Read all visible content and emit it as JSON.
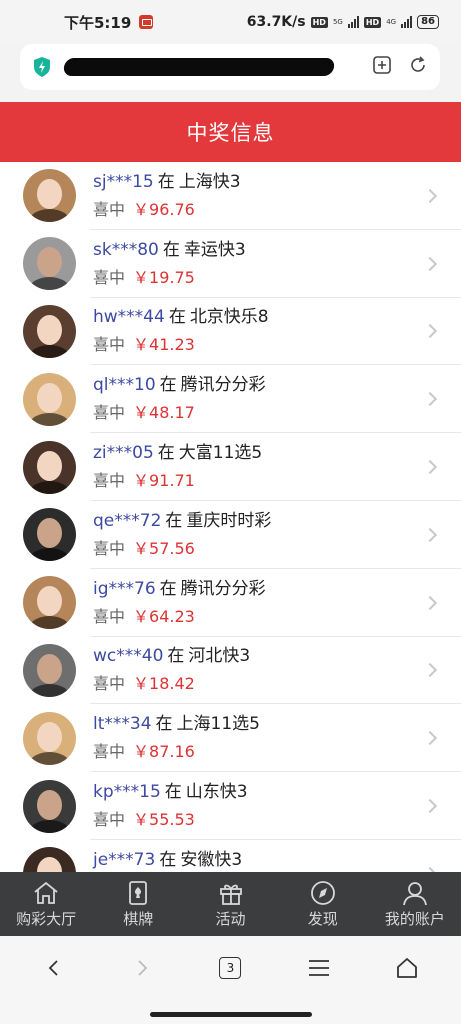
{
  "status": {
    "time": "下午5:19",
    "speed": "63.7K/s",
    "hd1": "HD",
    "net1": "5G",
    "hd2": "HD",
    "net2": "4G",
    "battery": "86"
  },
  "header": {
    "title": "中奖信息"
  },
  "list": {
    "items": [
      {
        "user": "sj***15",
        "zai": "在",
        "game": "上海快3",
        "label": "喜中",
        "amount": "￥96.76"
      },
      {
        "user": "sk***80",
        "zai": "在",
        "game": "幸运快3",
        "label": "喜中",
        "amount": "￥19.75"
      },
      {
        "user": "hw***44",
        "zai": "在",
        "game": "北京快乐8",
        "label": "喜中",
        "amount": "￥41.23"
      },
      {
        "user": "ql***10",
        "zai": "在",
        "game": "腾讯分分彩",
        "label": "喜中",
        "amount": "￥48.17"
      },
      {
        "user": "zi***05",
        "zai": "在",
        "game": "大富11选5",
        "label": "喜中",
        "amount": "￥91.71"
      },
      {
        "user": "qe***72",
        "zai": "在",
        "game": "重庆时时彩",
        "label": "喜中",
        "amount": "￥57.56"
      },
      {
        "user": "ig***76",
        "zai": "在",
        "game": "腾讯分分彩",
        "label": "喜中",
        "amount": "￥64.23"
      },
      {
        "user": "wc***40",
        "zai": "在",
        "game": "河北快3",
        "label": "喜中",
        "amount": "￥18.42"
      },
      {
        "user": "lt***34",
        "zai": "在",
        "game": "上海11选5",
        "label": "喜中",
        "amount": "￥87.16"
      },
      {
        "user": "kp***15",
        "zai": "在",
        "game": "山东快3",
        "label": "喜中",
        "amount": "￥55.53"
      },
      {
        "user": "je***73",
        "zai": "在",
        "game": "安徽快3",
        "label": "",
        "amount": ""
      }
    ]
  },
  "nav": {
    "items": [
      {
        "label": "购彩大厅",
        "icon": "home-icon"
      },
      {
        "label": "棋牌",
        "icon": "cards-icon"
      },
      {
        "label": "活动",
        "icon": "gift-icon"
      },
      {
        "label": "发现",
        "icon": "compass-icon"
      },
      {
        "label": "我的账户",
        "icon": "user-icon"
      }
    ]
  },
  "browser": {
    "tab_count": "3"
  },
  "colors": {
    "header_red": "#e3393c",
    "username_blue": "#3d4aa3",
    "amount_red": "#d33",
    "nav_bg": "#3b3d3f"
  }
}
